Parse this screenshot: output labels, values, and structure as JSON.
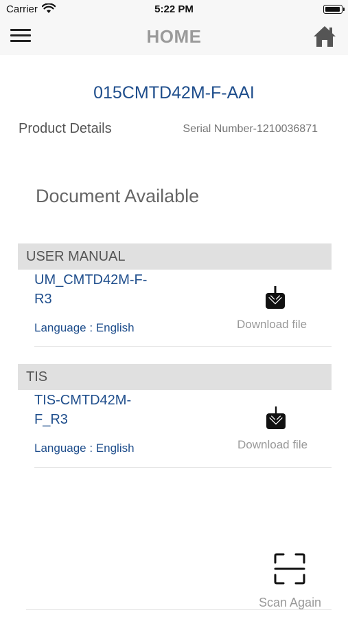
{
  "status": {
    "carrier": "Carrier",
    "time": "5:22 PM"
  },
  "nav": {
    "title": "HOME"
  },
  "product": {
    "model": "015CMTD42M-F-AAI",
    "details_label": "Product Details",
    "serial": "Serial Number-1210036871"
  },
  "documents_heading": "Document Available",
  "sections": [
    {
      "header": "USER MANUAL",
      "name_line1": "UM_CMTD42M-F-",
      "name_line2": "R3",
      "language": "Language : English",
      "download_label": "Download file"
    },
    {
      "header": "TIS",
      "name_line1": "TIS-CMTD42M-",
      "name_line2": "F_R3",
      "language": "Language : English",
      "download_label": "Download file"
    }
  ],
  "scan": {
    "label": "Scan Again"
  },
  "colors": {
    "accent": "#1f4e8c",
    "nav_title": "#9a9a9a",
    "section_bg": "#e0e0e0"
  },
  "icons": [
    "wifi-icon",
    "battery-icon",
    "menu-icon",
    "home-icon",
    "download-icon",
    "scan-icon"
  ]
}
